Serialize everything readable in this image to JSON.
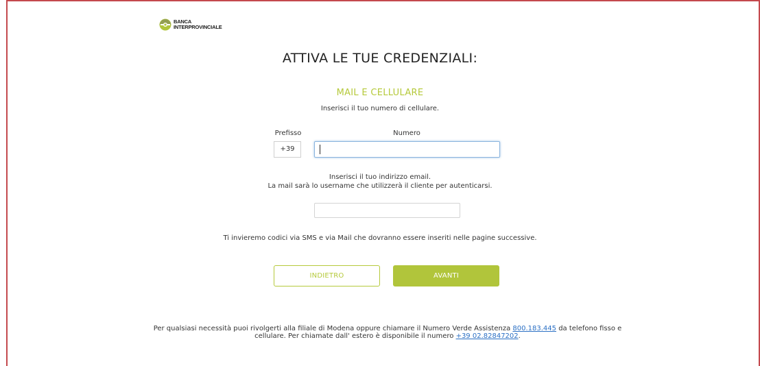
{
  "brand": {
    "name_line1": "BANCA",
    "name_line2": "INTERPROVINCIALE",
    "logo_icon": "banca-logo-icon",
    "colors": {
      "logo_primary": "#b1c53b",
      "logo_secondary": "#6e6e6e"
    }
  },
  "page": {
    "title": "ATTIVA LE TUE CREDENZIALI:",
    "section_title": "MAIL E CELLULARE",
    "phone_instruction": "Inserisci il tuo numero di cellulare.",
    "email_instruction_line1": "Inserisci il tuo indirizzo email.",
    "email_instruction_line2": "La mail sarà lo username che utilizzerà il cliente per autenticarsi.",
    "sms_note": "Ti invieremo codici via SMS e via Mail che dovranno essere inseriti nelle pagine successive."
  },
  "form": {
    "prefix_label": "Prefisso",
    "prefix_value": "+39",
    "number_label": "Numero",
    "number_value": "",
    "email_value": ""
  },
  "buttons": {
    "back_label": "INDIETRO",
    "next_label": "AVANTI"
  },
  "footer": {
    "text_part1": "Per qualsiasi necessità puoi rivolgerti alla filiale di Modena oppure chiamare il Numero Verde Assistenza",
    "phone_link": "800.183.445",
    "text_part2": "da telefono fisso e cellulare. Per chiamate dall' estero è disponibile il numero",
    "intl_link": "+39 02.82847202",
    "text_end": "."
  },
  "colors": {
    "accent": "#b5c93a",
    "button_fill": "#b1c53b",
    "frame": "#c4484d",
    "link": "#2a6fc4",
    "focus_border": "#8ab4de"
  }
}
